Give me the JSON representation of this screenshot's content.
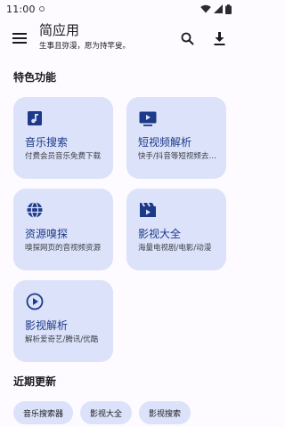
{
  "status_bar": {
    "time": "11:00"
  },
  "app_bar": {
    "title": "简应用",
    "subtitle": "生事且弥漫，愿为持竿叟。"
  },
  "features": {
    "heading": "特色功能",
    "cards": [
      {
        "icon": "music-note-icon",
        "title": "音乐搜索",
        "desc": "付费会员音乐免费下载"
      },
      {
        "icon": "tv-play-icon",
        "title": "短视频解析",
        "desc": "快手/抖音等短视频去水印"
      },
      {
        "icon": "globe-icon",
        "title": "资源嗅探",
        "desc": "嗅探网页的音视频资源"
      },
      {
        "icon": "movie-clapper-icon",
        "title": "影视大全",
        "desc": "海量电视剧/电影/动漫"
      },
      {
        "icon": "play-circle-icon",
        "title": "影视解析",
        "desc": "解析爱奇艺/腾讯/优酷"
      }
    ]
  },
  "recent": {
    "heading": "近期更新",
    "chips": [
      "音乐搜索器",
      "影视大全",
      "影视搜索"
    ]
  },
  "colors": {
    "accent": "#1d3a8a",
    "card_bg": "#dbe2f9",
    "background": "#fdfbff"
  }
}
